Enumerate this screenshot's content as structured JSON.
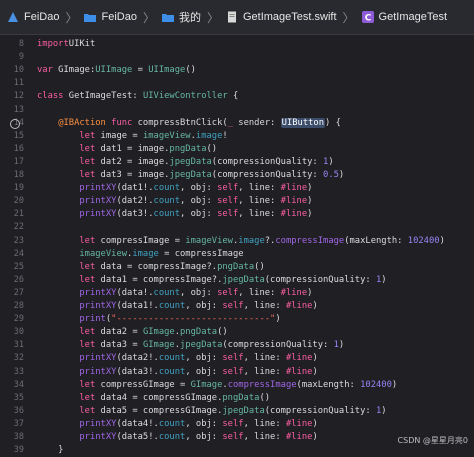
{
  "breadcrumbs": [
    {
      "icon": "app-icon",
      "label": "FeiDao"
    },
    {
      "icon": "folder-icon",
      "label": "FeiDao"
    },
    {
      "icon": "folder-icon",
      "label": "我的"
    },
    {
      "icon": "swift-file-icon",
      "label": "GetImageTest.swift"
    },
    {
      "icon": "class-c-icon",
      "label": "GetImageTest"
    }
  ],
  "code": [
    {
      "n": "8",
      "parts": [
        [
          "kw",
          "import"
        ],
        [
          "",
          "UIKit"
        ]
      ]
    },
    {
      "n": "9",
      "parts": []
    },
    {
      "n": "10",
      "parts": [
        [
          "kw",
          "var"
        ],
        [
          "",
          " GImage:"
        ],
        [
          "ty",
          "UIImage"
        ],
        [
          "",
          " = "
        ],
        [
          "ty",
          "UIImage"
        ],
        [
          "",
          "()"
        ]
      ]
    },
    {
      "n": "11",
      "parts": []
    },
    {
      "n": "12",
      "parts": [
        [
          "kw",
          "class"
        ],
        [
          "",
          " GetImageTest: "
        ],
        [
          "ty",
          "UIViewController"
        ],
        [
          "",
          " {"
        ]
      ]
    },
    {
      "n": "13",
      "parts": []
    },
    {
      "n": "14",
      "bp": true,
      "parts": [
        [
          "",
          "    "
        ],
        [
          "attr",
          "@IBAction"
        ],
        [
          "",
          " "
        ],
        [
          "kw",
          "func"
        ],
        [
          "",
          " compressBtnClick("
        ],
        [
          "kw",
          "_"
        ],
        [
          "",
          " sender: "
        ],
        [
          "hl",
          "UIButton"
        ],
        [
          "",
          ") {"
        ]
      ]
    },
    {
      "n": "15",
      "parts": [
        [
          "",
          "        "
        ],
        [
          "kw",
          "let"
        ],
        [
          "",
          " image = "
        ],
        [
          "ivar",
          "imageView"
        ],
        [
          "",
          "."
        ],
        [
          "prop",
          "image"
        ],
        [
          "",
          "!"
        ]
      ]
    },
    {
      "n": "16",
      "parts": [
        [
          "",
          "        "
        ],
        [
          "kw",
          "let"
        ],
        [
          "",
          " dat1 = image."
        ],
        [
          "mth",
          "pngData"
        ],
        [
          "",
          "()"
        ]
      ]
    },
    {
      "n": "17",
      "parts": [
        [
          "",
          "        "
        ],
        [
          "kw",
          "let"
        ],
        [
          "",
          " dat2 = image."
        ],
        [
          "mth",
          "jpegData"
        ],
        [
          "",
          "(compressionQuality: "
        ],
        [
          "num",
          "1"
        ],
        [
          "",
          ")"
        ]
      ]
    },
    {
      "n": "18",
      "parts": [
        [
          "",
          "        "
        ],
        [
          "kw",
          "let"
        ],
        [
          "",
          " dat3 = image."
        ],
        [
          "mth",
          "jpegData"
        ],
        [
          "",
          "(compressionQuality: "
        ],
        [
          "num",
          "0.5"
        ],
        [
          "",
          ")"
        ]
      ]
    },
    {
      "n": "19",
      "parts": [
        [
          "",
          "        "
        ],
        [
          "fn",
          "printXY"
        ],
        [
          "",
          "(dat1!."
        ],
        [
          "prop",
          "count"
        ],
        [
          "",
          ", obj: "
        ],
        [
          "kw",
          "self"
        ],
        [
          "",
          ", line: "
        ],
        [
          "kw",
          "#line"
        ],
        [
          "",
          ")"
        ]
      ]
    },
    {
      "n": "20",
      "parts": [
        [
          "",
          "        "
        ],
        [
          "fn",
          "printXY"
        ],
        [
          "",
          "(dat2!."
        ],
        [
          "prop",
          "count"
        ],
        [
          "",
          ", obj: "
        ],
        [
          "kw",
          "self"
        ],
        [
          "",
          ", line: "
        ],
        [
          "kw",
          "#line"
        ],
        [
          "",
          ")"
        ]
      ]
    },
    {
      "n": "21",
      "parts": [
        [
          "",
          "        "
        ],
        [
          "fn",
          "printXY"
        ],
        [
          "",
          "(dat3!."
        ],
        [
          "prop",
          "count"
        ],
        [
          "",
          ", obj: "
        ],
        [
          "kw",
          "self"
        ],
        [
          "",
          ", line: "
        ],
        [
          "kw",
          "#line"
        ],
        [
          "",
          ")"
        ]
      ]
    },
    {
      "n": "22",
      "parts": []
    },
    {
      "n": "23",
      "parts": [
        [
          "",
          "        "
        ],
        [
          "kw",
          "let"
        ],
        [
          "",
          " compressImage = "
        ],
        [
          "ivar",
          "imageView"
        ],
        [
          "",
          "."
        ],
        [
          "prop",
          "image"
        ],
        [
          "",
          "?."
        ],
        [
          "fn",
          "compressImage"
        ],
        [
          "",
          "(maxLength: "
        ],
        [
          "num",
          "102400"
        ],
        [
          "",
          ")"
        ]
      ]
    },
    {
      "n": "24",
      "parts": [
        [
          "",
          "        "
        ],
        [
          "ivar",
          "imageView"
        ],
        [
          "",
          "."
        ],
        [
          "prop",
          "image"
        ],
        [
          "",
          " = compressImage"
        ]
      ]
    },
    {
      "n": "25",
      "parts": [
        [
          "",
          "        "
        ],
        [
          "kw",
          "let"
        ],
        [
          "",
          " data = compressImage?."
        ],
        [
          "mth",
          "pngData"
        ],
        [
          "",
          "()"
        ]
      ]
    },
    {
      "n": "26",
      "parts": [
        [
          "",
          "        "
        ],
        [
          "kw",
          "let"
        ],
        [
          "",
          " data1 = compressImage?."
        ],
        [
          "mth",
          "jpegData"
        ],
        [
          "",
          "(compressionQuality: "
        ],
        [
          "num",
          "1"
        ],
        [
          "",
          ")"
        ]
      ]
    },
    {
      "n": "27",
      "parts": [
        [
          "",
          "        "
        ],
        [
          "fn",
          "printXY"
        ],
        [
          "",
          "(data!."
        ],
        [
          "prop",
          "count"
        ],
        [
          "",
          ", obj: "
        ],
        [
          "kw",
          "self"
        ],
        [
          "",
          ", line: "
        ],
        [
          "kw",
          "#line"
        ],
        [
          "",
          ")"
        ]
      ]
    },
    {
      "n": "28",
      "parts": [
        [
          "",
          "        "
        ],
        [
          "fn",
          "printXY"
        ],
        [
          "",
          "(data1!."
        ],
        [
          "prop",
          "count"
        ],
        [
          "",
          ", obj: "
        ],
        [
          "kw",
          "self"
        ],
        [
          "",
          ", line: "
        ],
        [
          "kw",
          "#line"
        ],
        [
          "",
          ")"
        ]
      ]
    },
    {
      "n": "29",
      "parts": [
        [
          "",
          "        "
        ],
        [
          "fn",
          "print"
        ],
        [
          "",
          "("
        ],
        [
          "str",
          "\"-----------------------------\""
        ],
        [
          "",
          ")"
        ]
      ]
    },
    {
      "n": "30",
      "parts": [
        [
          "",
          "        "
        ],
        [
          "kw",
          "let"
        ],
        [
          "",
          " data2 = "
        ],
        [
          "ivar",
          "GImage"
        ],
        [
          "",
          "."
        ],
        [
          "mth",
          "pngData"
        ],
        [
          "",
          "()"
        ]
      ]
    },
    {
      "n": "31",
      "parts": [
        [
          "",
          "        "
        ],
        [
          "kw",
          "let"
        ],
        [
          "",
          " data3 = "
        ],
        [
          "ivar",
          "GImage"
        ],
        [
          "",
          "."
        ],
        [
          "mth",
          "jpegData"
        ],
        [
          "",
          "(compressionQuality: "
        ],
        [
          "num",
          "1"
        ],
        [
          "",
          ")"
        ]
      ]
    },
    {
      "n": "32",
      "parts": [
        [
          "",
          "        "
        ],
        [
          "fn",
          "printXY"
        ],
        [
          "",
          "(data2!."
        ],
        [
          "prop",
          "count"
        ],
        [
          "",
          ", obj: "
        ],
        [
          "kw",
          "self"
        ],
        [
          "",
          ", line: "
        ],
        [
          "kw",
          "#line"
        ],
        [
          "",
          ")"
        ]
      ]
    },
    {
      "n": "33",
      "parts": [
        [
          "",
          "        "
        ],
        [
          "fn",
          "printXY"
        ],
        [
          "",
          "(data3!."
        ],
        [
          "prop",
          "count"
        ],
        [
          "",
          ", obj: "
        ],
        [
          "kw",
          "self"
        ],
        [
          "",
          ", line: "
        ],
        [
          "kw",
          "#line"
        ],
        [
          "",
          ")"
        ]
      ]
    },
    {
      "n": "34",
      "parts": [
        [
          "",
          "        "
        ],
        [
          "kw",
          "let"
        ],
        [
          "",
          " compressGImage = "
        ],
        [
          "ivar",
          "GImage"
        ],
        [
          "",
          "."
        ],
        [
          "fn",
          "compressImage"
        ],
        [
          "",
          "(maxLength: "
        ],
        [
          "num",
          "102400"
        ],
        [
          "",
          ")"
        ]
      ]
    },
    {
      "n": "35",
      "parts": [
        [
          "",
          "        "
        ],
        [
          "kw",
          "let"
        ],
        [
          "",
          " data4 = compressGImage."
        ],
        [
          "mth",
          "pngData"
        ],
        [
          "",
          "()"
        ]
      ]
    },
    {
      "n": "36",
      "parts": [
        [
          "",
          "        "
        ],
        [
          "kw",
          "let"
        ],
        [
          "",
          " data5 = compressGImage."
        ],
        [
          "mth",
          "jpegData"
        ],
        [
          "",
          "(compressionQuality: "
        ],
        [
          "num",
          "1"
        ],
        [
          "",
          ")"
        ]
      ]
    },
    {
      "n": "37",
      "parts": [
        [
          "",
          "        "
        ],
        [
          "fn",
          "printXY"
        ],
        [
          "",
          "(data4!."
        ],
        [
          "prop",
          "count"
        ],
        [
          "",
          ", obj: "
        ],
        [
          "kw",
          "self"
        ],
        [
          "",
          ", line: "
        ],
        [
          "kw",
          "#line"
        ],
        [
          "",
          ")"
        ]
      ]
    },
    {
      "n": "38",
      "parts": [
        [
          "",
          "        "
        ],
        [
          "fn",
          "printXY"
        ],
        [
          "",
          "(data5!."
        ],
        [
          "prop",
          "count"
        ],
        [
          "",
          ", obj: "
        ],
        [
          "kw",
          "self"
        ],
        [
          "",
          ", line: "
        ],
        [
          "kw",
          "#line"
        ],
        [
          "",
          ")"
        ]
      ]
    },
    {
      "n": "39",
      "parts": [
        [
          "",
          "    }"
        ]
      ]
    }
  ],
  "watermark": "CSDN @星星月亮0",
  "colors": {
    "background": "#1f1f24",
    "keyword": "#fc5fa3",
    "type": "#67b7a4",
    "number": "#9686f5",
    "string": "#fc6a5d"
  }
}
